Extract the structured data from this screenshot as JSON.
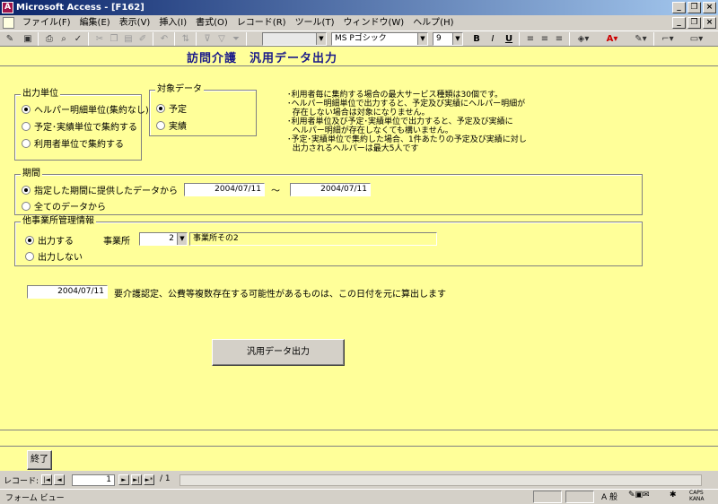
{
  "window": {
    "title": "Microsoft Access - [F162]",
    "app_icon": "access-icon",
    "controls": {
      "minimize": "_",
      "restore": "❐",
      "close": "×"
    }
  },
  "menu": {
    "items": [
      "ファイル(F)",
      "編集(E)",
      "表示(V)",
      "挿入(I)",
      "書式(O)",
      "レコード(R)",
      "ツール(T)",
      "ウィンドウ(W)",
      "ヘルプ(H)"
    ]
  },
  "toolbar": {
    "font_name": "MS Pゴシック",
    "font_size": "9",
    "bold": "B",
    "italic": "I",
    "underline": "U",
    "font_color": "A"
  },
  "form": {
    "title": "訪問介護　汎用データ出力",
    "output_unit": {
      "label": "出力単位",
      "options": [
        "ヘルパー明細単位(集約なし)",
        "予定･実績単位で集約する",
        "利用者単位で集約する"
      ],
      "selected": 0
    },
    "target_data": {
      "label": "対象データ",
      "options": [
        "予定",
        "実績"
      ],
      "selected": 0
    },
    "notes": "･利用者毎に集約する場合の最大サービス種類は30個です。\n･ヘルパー明細単位で出力すると、予定及び実績にヘルパー明細が\n  存在しない場合は対象になりません。\n･利用者単位及び予定･実績単位で出力すると、予定及び実績に\n  ヘルパー明細が存在しなくても構いません。\n･予定･実績単位で集約した場合、1件あたりの予定及び実績に対し\n  出力されるヘルパーは最大5人です",
    "period": {
      "label": "期間",
      "options": [
        "指定した期間に提供したデータから",
        "全てのデータから"
      ],
      "selected": 0,
      "from": "2004/07/11",
      "separator": "～",
      "to": "2004/07/11"
    },
    "other_office": {
      "label": "他事業所管理情報",
      "options": [
        "出力する",
        "出力しない"
      ],
      "selected": 0,
      "office_label": "事業所",
      "office_number": "2",
      "office_name": "事業所その2"
    },
    "base_date": {
      "value": "2004/07/11",
      "description": "要介護認定、公費等複数存在する可能性があるものは、この日付を元に算出します"
    },
    "export_button": "汎用データ出力",
    "exit_button": "終了"
  },
  "navigation": {
    "label": "レコード:",
    "current": "1",
    "total": "/ 1"
  },
  "status": {
    "text": "フォーム ビュー",
    "ime": "A 般",
    "caps": "CAPS",
    "kana": "KANA"
  }
}
